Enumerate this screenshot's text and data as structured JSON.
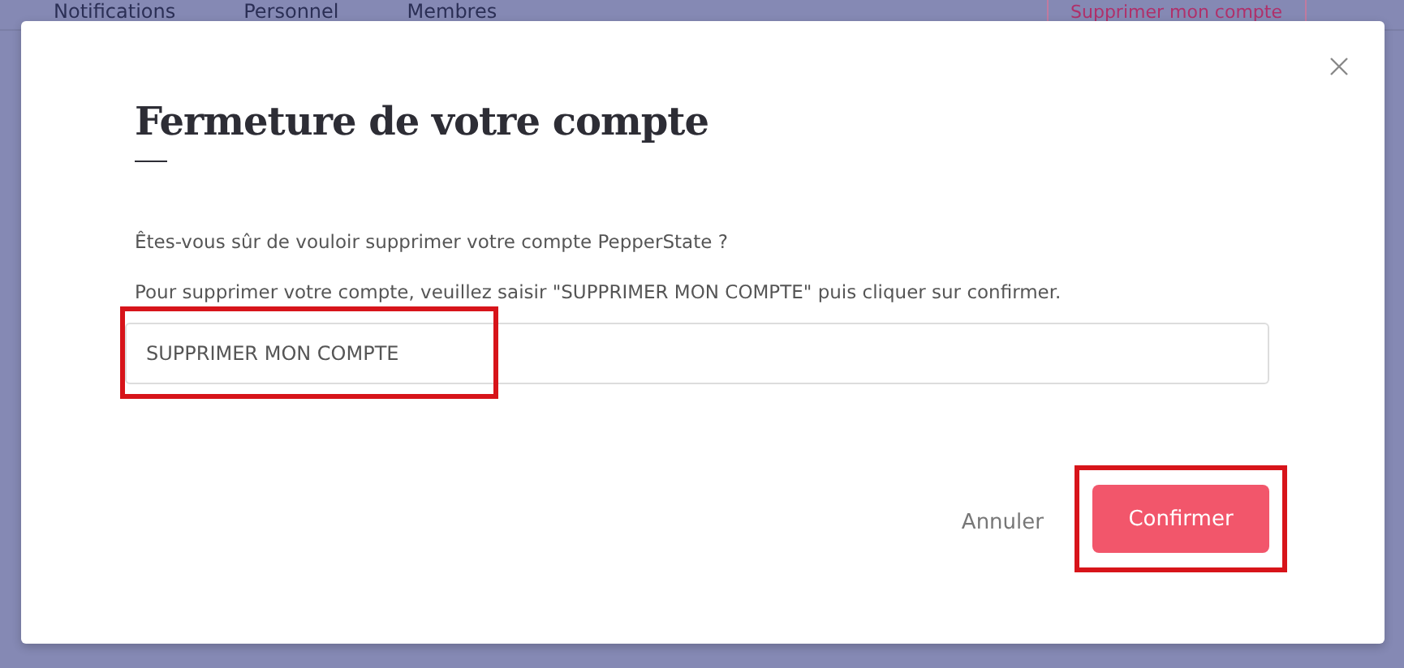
{
  "background": {
    "tabs": [
      {
        "label": "Notifications"
      },
      {
        "label": "Personnel"
      },
      {
        "label": "Membres"
      }
    ],
    "delete_button": {
      "label": "Supprimer mon compte"
    }
  },
  "dialog": {
    "title": "Fermeture de votre compte",
    "question": "Êtes-vous sûr de vouloir supprimer votre compte PepperState ?",
    "instruction": "Pour supprimer votre compte, veuillez saisir \"SUPPRIMER MON COMPTE\" puis cliquer sur confirmer.",
    "input": {
      "value": "SUPPRIMER MON COMPTE",
      "highlighted": true
    },
    "buttons": [
      {
        "kind": "link",
        "label": "Annuler",
        "highlighted": false
      },
      {
        "kind": "primary",
        "label": "Confirmer",
        "highlighted": true
      }
    ]
  }
}
